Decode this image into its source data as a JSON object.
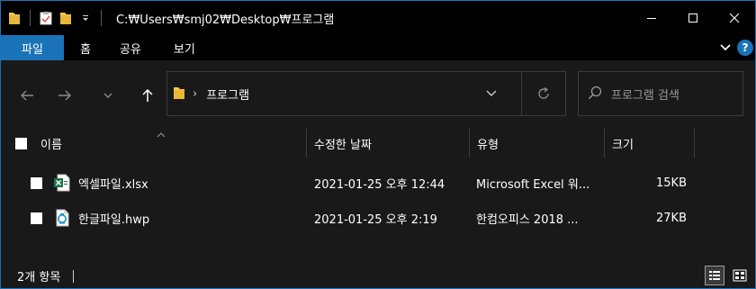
{
  "window": {
    "title": "C:₩Users₩smj02₩Desktop₩프로그램",
    "controls": [
      "minimize-icon",
      "maximize-icon",
      "close-icon"
    ]
  },
  "ribbon": {
    "file_tab": "파일",
    "tabs": [
      "홈",
      "공유",
      "보기"
    ]
  },
  "address": {
    "path": "프로그램"
  },
  "search": {
    "placeholder": "프로그램 검색"
  },
  "columns": {
    "name": "이름",
    "modified": "수정한 날짜",
    "type": "유형",
    "size": "크기"
  },
  "files": [
    {
      "name": "엑셀파일.xlsx",
      "modified": "2021-01-25 오후 12:44",
      "type": "Microsoft Excel 워...",
      "size": "15KB",
      "icon": "excel-file-icon"
    },
    {
      "name": "한글파일.hwp",
      "modified": "2021-01-25 오후 2:19",
      "type": "한컴오피스 2018 ...",
      "size": "27KB",
      "icon": "hwp-file-icon"
    }
  ],
  "status": {
    "item_count": "2개 항목"
  },
  "colors": {
    "accent": "#1a73b8",
    "background": "#191919",
    "titlebar": "#000000"
  }
}
